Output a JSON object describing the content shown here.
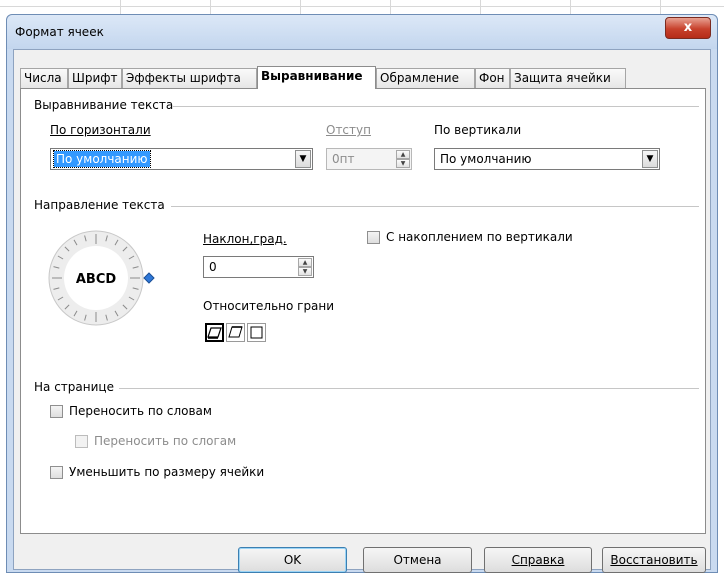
{
  "window": {
    "title": "Формат ячеек",
    "close_label": "x"
  },
  "tabs": [
    {
      "label": "Числа"
    },
    {
      "label": "Шрифт"
    },
    {
      "label": "Эффекты шрифта"
    },
    {
      "label": "Выравнивание",
      "active": true
    },
    {
      "label": "Обрамление"
    },
    {
      "label": "Фон"
    },
    {
      "label": "Защита ячейки"
    }
  ],
  "text_alignment": {
    "section_label": "Выравнивание текста",
    "horizontal_label": "По горизонтали",
    "horizontal_value": "По умолчанию",
    "indent_label": "Отступ",
    "indent_value": "0пт",
    "vertical_label": "По вертикали",
    "vertical_value": "По умолчанию"
  },
  "text_direction": {
    "section_label": "Направление текста",
    "dial_text": "ABCD",
    "angle_label": "Наклон,град.",
    "angle_value": "0",
    "stacked_label": "С накоплением по вертикали",
    "reference_edge_label": "Относительно грани"
  },
  "on_page": {
    "section_label": "На странице",
    "wrap_words": "Переносить по словам",
    "hyphenation": "Переносить по слогам",
    "shrink_to_fit": "Уменьшить по размеру ячейки"
  },
  "buttons": {
    "ok": "OK",
    "cancel": "Отмена",
    "help": "Справка",
    "reset": "Восстановить"
  }
}
